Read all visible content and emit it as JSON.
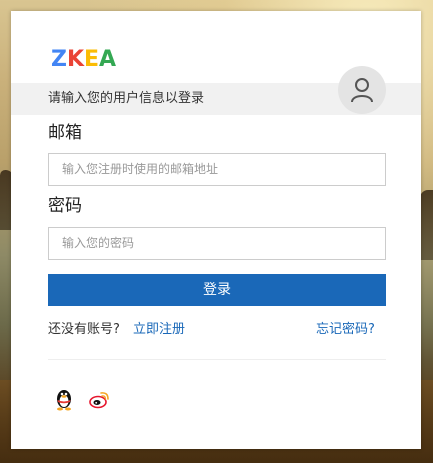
{
  "logo": {
    "letters": [
      "Z",
      "K",
      "E",
      "A"
    ],
    "colors": [
      "#4285f4",
      "#ea4335",
      "#fbbc05",
      "#34a853"
    ]
  },
  "hint": "请输入您的用户信息以登录",
  "avatar_icon": "user-icon",
  "email": {
    "label": "邮箱",
    "placeholder": "输入您注册时使用的邮箱地址",
    "value": ""
  },
  "password": {
    "label": "密码",
    "placeholder": "输入您的密码",
    "value": ""
  },
  "login_button": "登录",
  "footer": {
    "no_account": "还没有账号?",
    "register": "立即注册",
    "forgot": "忘记密码?"
  },
  "social": {
    "qq_icon": "qq-penguin-icon",
    "weibo_icon": "weibo-icon"
  },
  "colors": {
    "primary": "#1a68b8",
    "hint_bar": "#f1f1f1"
  }
}
